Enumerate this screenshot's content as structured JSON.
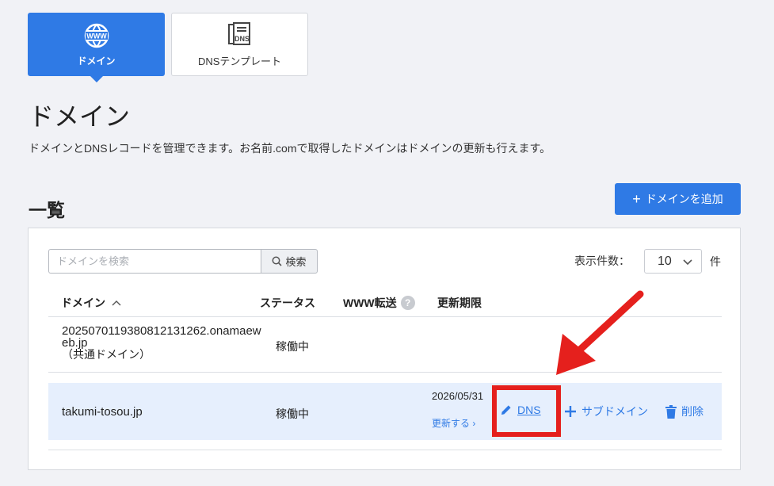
{
  "tabs": [
    {
      "label": "ドメイン",
      "icon": "globe-www-icon",
      "active": true
    },
    {
      "label": "DNSテンプレート",
      "icon": "dns-document-icon",
      "active": false
    }
  ],
  "dns_icon_text": "DNS",
  "www_icon_text": "WWW",
  "page": {
    "title": "ドメイン",
    "description": "ドメインとDNSレコードを管理できます。お名前.comで取得したドメインはドメインの更新も行えます。"
  },
  "list": {
    "title": "一覧",
    "add_button": "ドメインを追加",
    "search_placeholder": "ドメインを検索",
    "search_button": "検索",
    "perpage_label": "表示件数：",
    "perpage_value": "10",
    "perpage_unit": "件",
    "columns": [
      "ドメイン",
      "ステータス",
      "WWW転送",
      "更新期限"
    ],
    "help_icon": "?",
    "rows": [
      {
        "domain": "20250701193808121312​62.onamaeweb.jp",
        "domain_display": "202507011938081213126​2.onamaeweb.jp",
        "domain_sub": "（共通ドメイン）",
        "status": "稼働中"
      },
      {
        "domain": "takumi-tosou.jp",
        "status": "稼働中",
        "expire": "2026/05/31",
        "renew": "更新する ›",
        "actions": {
          "dns": "DNS",
          "subdomain": "サブドメイン",
          "delete": "削除"
        }
      }
    ]
  },
  "colors": {
    "accent": "#2f7ae5",
    "annotation": "#e5201d",
    "row_highlight": "#e6effd"
  }
}
